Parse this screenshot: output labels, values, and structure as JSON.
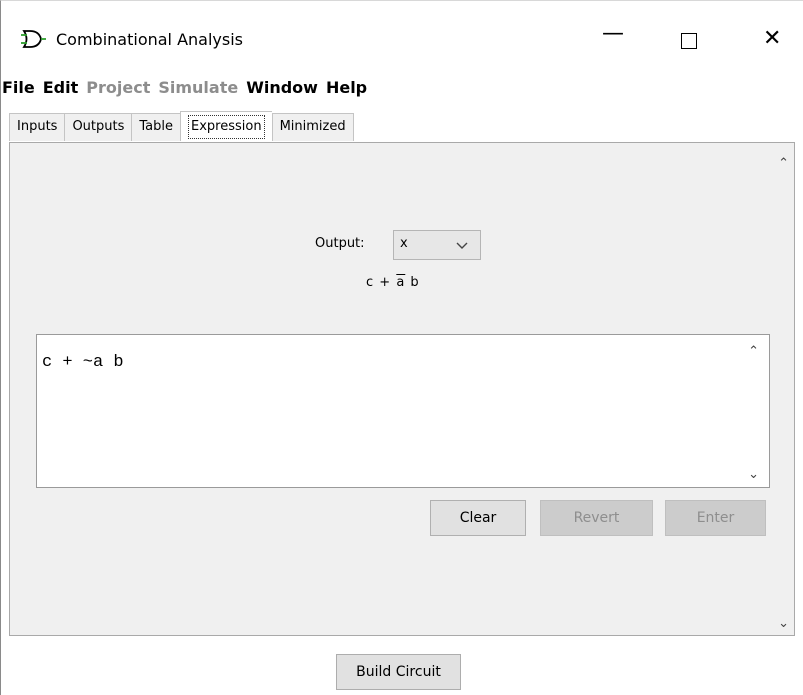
{
  "window": {
    "title": "Combinational Analysis",
    "controls": {
      "minimize": "—",
      "close": "✕"
    }
  },
  "menu": {
    "items": [
      {
        "label": "File",
        "enabled": true
      },
      {
        "label": "Edit",
        "enabled": true
      },
      {
        "label": "Project",
        "enabled": false
      },
      {
        "label": "Simulate",
        "enabled": false
      },
      {
        "label": "Window",
        "enabled": true
      },
      {
        "label": "Help",
        "enabled": true
      }
    ]
  },
  "tabs": [
    {
      "label": "Inputs",
      "active": false
    },
    {
      "label": "Outputs",
      "active": false
    },
    {
      "label": "Table",
      "active": false
    },
    {
      "label": "Expression",
      "active": true
    },
    {
      "label": "Minimized",
      "active": false
    }
  ],
  "expression_tab": {
    "output_label": "Output:",
    "output_selected": "x",
    "rendered_expression": {
      "prefix": "c + ",
      "negated": "a",
      "suffix": " b"
    },
    "expression_text": "c + ~a b",
    "buttons": {
      "clear": {
        "label": "Clear",
        "enabled": true
      },
      "revert": {
        "label": "Revert",
        "enabled": false
      },
      "enter": {
        "label": "Enter",
        "enabled": false
      }
    }
  },
  "footer": {
    "build_label": "Build Circuit"
  },
  "icons": {
    "app": "logic-gate-icon",
    "chevron": "chevron-down-icon",
    "scroll_up": "scroll-up-arrow-icon",
    "scroll_down": "scroll-down-arrow-icon"
  },
  "colors": {
    "panel_bg": "#f0f0f0",
    "disabled_text": "#8d8d8d",
    "gate_icon": "#000000",
    "gate_icon_accent": "#2e9f2e"
  }
}
